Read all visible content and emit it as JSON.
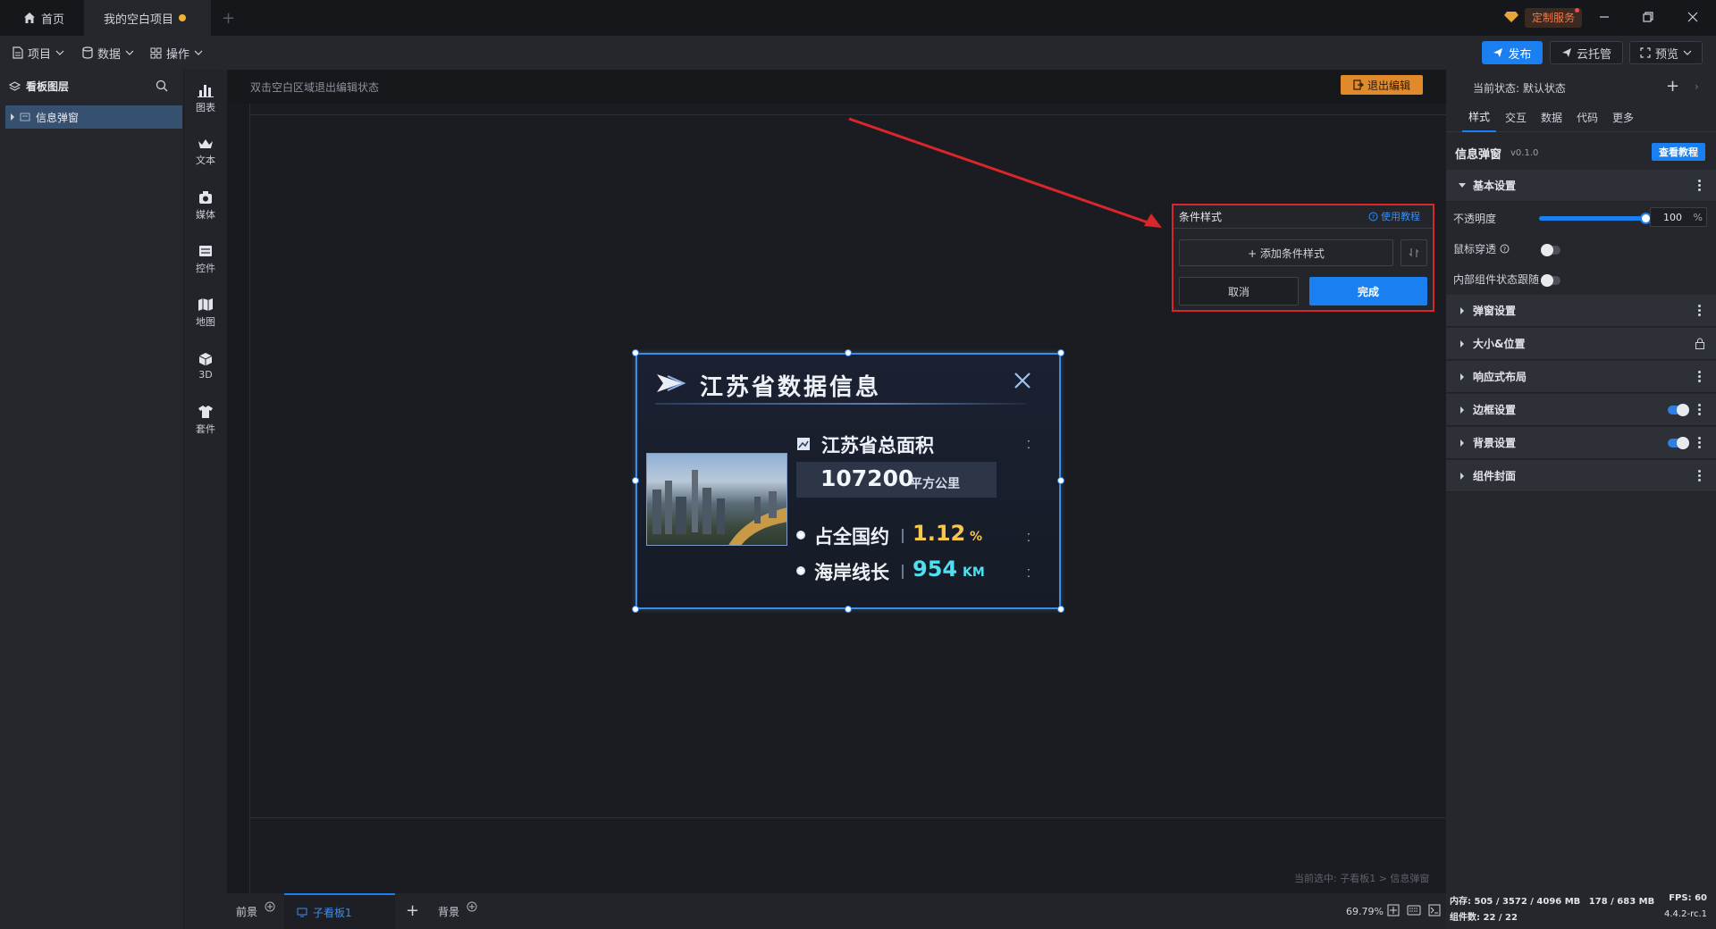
{
  "titlebar": {
    "tabs": [
      {
        "label": "首页",
        "icon": "home-icon"
      },
      {
        "label": "我的空白项目",
        "modified": true
      }
    ],
    "custom_service": "定制服务"
  },
  "menubar": {
    "items": [
      "项目",
      "数据",
      "操作"
    ],
    "publish": "发布",
    "cloud": "云托管",
    "preview": "预览"
  },
  "layers": {
    "title": "看板图层",
    "items": [
      {
        "label": "信息弹窗"
      }
    ]
  },
  "tools": [
    "图表",
    "文本",
    "媒体",
    "控件",
    "地图",
    "3D",
    "套件"
  ],
  "canvas": {
    "hint": "双击空白区域退出编辑状态",
    "exit_edit": "退出编辑",
    "selection_info": "当前选中: 子看板1 > 信息弹窗"
  },
  "widget": {
    "title": "江苏省数据信息",
    "area_label": "江苏省总面积",
    "area_value": "107200",
    "area_unit": "平方公里",
    "share_label": "占全国约",
    "share_value": "1.12",
    "share_unit": "%",
    "coast_label": "海岸线长",
    "coast_value": "954",
    "coast_unit": "KM"
  },
  "condition_popup": {
    "title": "条件样式",
    "tutorial": "使用教程",
    "add": "+ 添加条件样式",
    "cancel": "取消",
    "done": "完成"
  },
  "bottombar": {
    "front": "前景",
    "subboard": "子看板1",
    "background": "背景",
    "zoom": "69.79%"
  },
  "right_panel": {
    "state_label": "当前状态:",
    "state_value": "默认状态",
    "tabs": [
      "样式",
      "交互",
      "数据",
      "代码",
      "更多"
    ],
    "component_name": "信息弹窗",
    "version": "v0.1.0",
    "view_tutorial": "查看教程",
    "basic_settings": "基本设置",
    "opacity_label": "不透明度",
    "opacity_value": "100",
    "opacity_unit": "%",
    "opacity_fraction": 1.0,
    "mouse_through": "鼠标穿透",
    "inner_follow": "内部组件状态跟随",
    "sections": [
      "弹窗设置",
      "大小&位置",
      "响应式布局",
      "边框设置",
      "背景设置",
      "组件封面"
    ]
  },
  "status": {
    "memory_label": "内存:",
    "memory_value": "505 / 3572 / 4096 MB",
    "memory_value2": "178 / 683 MB",
    "fps_label": "FPS:",
    "fps_value": "60",
    "component_count_label": "组件数:",
    "component_count": "22 / 22",
    "version": "4.4.2-rc.1"
  },
  "colors": {
    "accent": "#1a7ff0",
    "selection": "#3a8ee6",
    "highlight_red": "#d9262b",
    "exit_orange": "#e08a2c",
    "value_gold": "#f5c84c",
    "value_cyan": "#4ee0f0"
  }
}
